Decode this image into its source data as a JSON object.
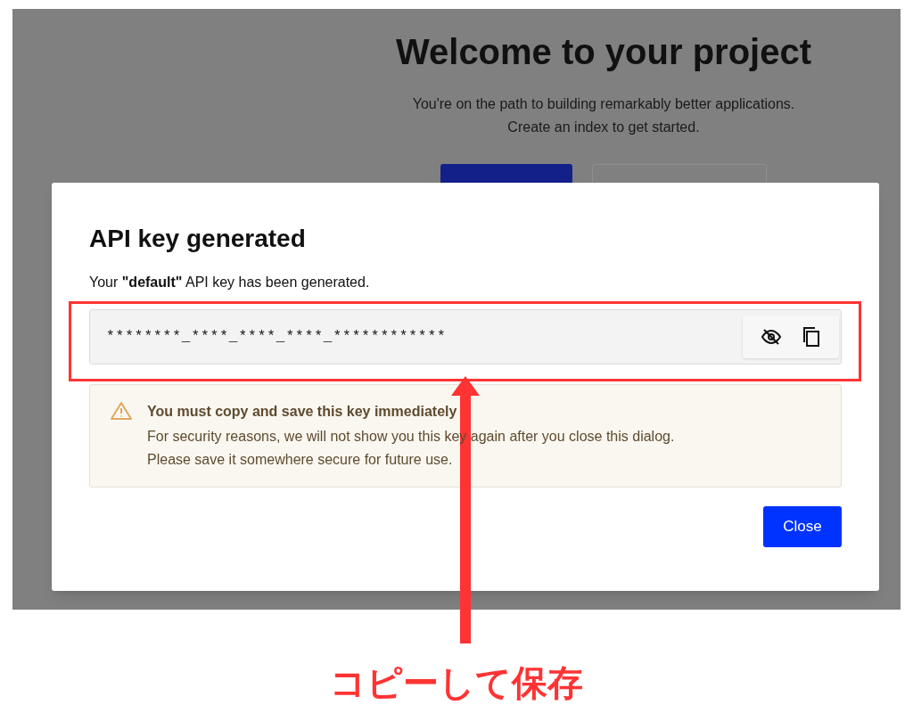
{
  "background_page": {
    "title": "Welcome to your project",
    "subtitle_lines": [
      "You're on the path to building remarkably better applications.",
      "Create an index to get started."
    ]
  },
  "dialog": {
    "title": "API key generated",
    "description": "Your **\"default\"** API key has been generated.",
    "api_key": "********_****_****_****_************",
    "warning": {
      "title": "You must copy and save this key immediately",
      "lines": [
        "For security reasons, we will not show you this key again after you close this dialog.",
        "Please save it somewhere secure for future use."
      ]
    },
    "close_button": "Close"
  },
  "annotation": {
    "label": "コピーして保存"
  }
}
